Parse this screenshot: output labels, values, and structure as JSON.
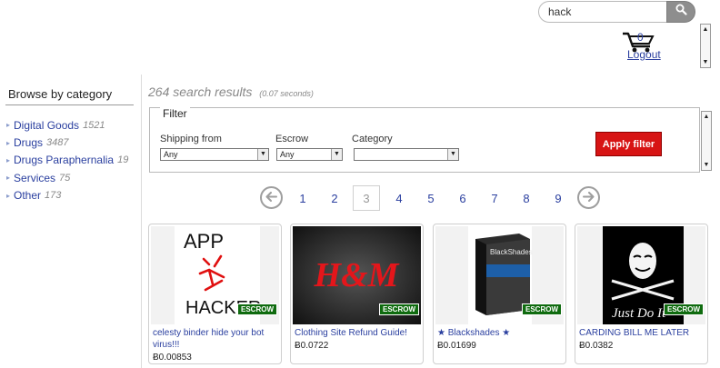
{
  "header": {
    "search_value": "hack",
    "search_icon": "search-icon",
    "cart_icon": "cart-icon",
    "cart_count": "0",
    "logout_label": "Logout"
  },
  "sidebar": {
    "title": "Browse by category",
    "categories": [
      {
        "name": "Digital Goods",
        "count": "1521"
      },
      {
        "name": "Drugs",
        "count": "3487"
      },
      {
        "name": "Drugs Paraphernalia",
        "count": "19"
      },
      {
        "name": "Services",
        "count": "75"
      },
      {
        "name": "Other",
        "count": "173"
      }
    ]
  },
  "results": {
    "count_text": "264 search results",
    "time_text": "(0.07 seconds)"
  },
  "filter": {
    "legend": "Filter",
    "shipping_label": "Shipping from",
    "shipping_value": "Any",
    "escrow_label": "Escrow",
    "escrow_value": "Any",
    "category_label": "Category",
    "category_value": "",
    "apply_label": "Apply filter"
  },
  "pagination": {
    "pages": [
      "1",
      "2",
      "3",
      "4",
      "5",
      "6",
      "7",
      "8",
      "9"
    ],
    "current": "3"
  },
  "products": [
    {
      "title": "celesty binder hide your bot virus!!!",
      "price": "Ƀ0.00853",
      "badge": "ESCROW",
      "image_text": [
        "APP",
        "HACKER"
      ]
    },
    {
      "title": "Clothing Site Refund Guide!",
      "price": "Ƀ0.0722",
      "badge": "ESCROW",
      "image_text": [
        "H&M"
      ]
    },
    {
      "title": "★ Blackshades ★",
      "price": "Ƀ0.01699",
      "badge": "ESCROW",
      "image_text": [
        "BlackShades"
      ]
    },
    {
      "title": "CARDING BILL ME LATER",
      "price": "Ƀ0.0382",
      "badge": "ESCROW",
      "image_text": [
        "Just Do It"
      ]
    }
  ],
  "colors": {
    "link": "#2a3f9f",
    "apply_button": "#d71414",
    "escrow_badge": "#0f6b0f"
  }
}
